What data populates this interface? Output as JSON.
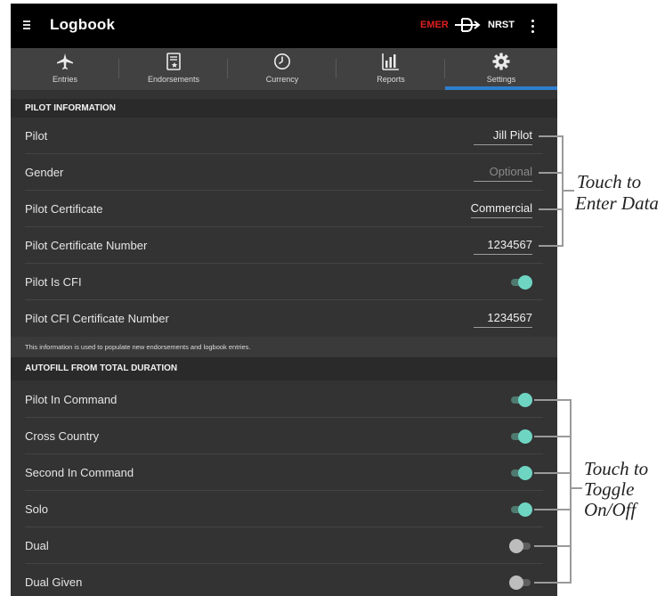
{
  "app": {
    "title": "Logbook",
    "emer_label": "EMER",
    "nrst_label": "NRST",
    "icons": {
      "menu": "menu-icon",
      "direct_to": "direct-to-icon",
      "more": "more-vert-icon"
    },
    "colors": {
      "emer": "#e02020",
      "accent": "#2e7fcf",
      "toggle_on": "#6fd5c3"
    }
  },
  "tabs": [
    {
      "label": "Entries",
      "icon": "airplane-icon",
      "active": false
    },
    {
      "label": "Endorsements",
      "icon": "certificate-icon",
      "active": false
    },
    {
      "label": "Currency",
      "icon": "clock-icon",
      "active": false
    },
    {
      "label": "Reports",
      "icon": "bar-chart-icon",
      "active": false
    },
    {
      "label": "Settings",
      "icon": "gear-icon",
      "active": true
    }
  ],
  "pilot_information": {
    "header": "PILOT INFORMATION",
    "pilot": {
      "label": "Pilot",
      "value": "Jill Pilot"
    },
    "gender": {
      "label": "Gender",
      "placeholder": "Optional"
    },
    "certificate": {
      "label": "Pilot Certificate",
      "value": "Commercial"
    },
    "certificate_number": {
      "label": "Pilot Certificate Number",
      "value": "1234567"
    },
    "is_cfi": {
      "label": "Pilot Is CFI",
      "on": true
    },
    "cfi_certificate_number": {
      "label": "Pilot CFI Certificate Number",
      "value": "1234567"
    },
    "note": "This information is used to populate new endorsements and logbook entries."
  },
  "autofill": {
    "header": "AUTOFILL FROM TOTAL DURATION",
    "items": [
      {
        "label": "Pilot In Command",
        "on": true
      },
      {
        "label": "Cross Country",
        "on": true
      },
      {
        "label": "Second In Command",
        "on": true
      },
      {
        "label": "Solo",
        "on": true
      },
      {
        "label": "Dual",
        "on": false
      },
      {
        "label": "Dual Given",
        "on": false
      }
    ]
  },
  "callouts": {
    "enter_data": [
      "Touch to",
      "Enter Data"
    ],
    "toggle": [
      "Touch to",
      "Toggle",
      "On/Off"
    ]
  }
}
